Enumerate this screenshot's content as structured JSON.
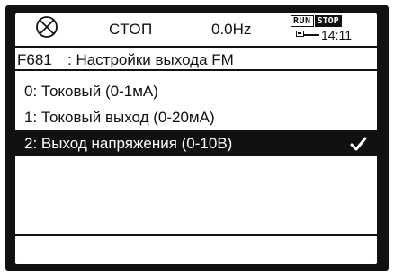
{
  "status": {
    "mode": "СТОП",
    "frequency": "0.0Hz",
    "run_label": "RUN",
    "stop_label": "STOP",
    "clock": "14:11"
  },
  "parameter": {
    "code": "F681",
    "title": ": Настройки выхода FM"
  },
  "options": [
    {
      "label": "0: Токовый (0-1мА)",
      "selected": false
    },
    {
      "label": "1: Токовый выход (0-20мА)",
      "selected": false
    },
    {
      "label": "2: Выход напряжения (0-10В)",
      "selected": true
    }
  ],
  "icons": {
    "stop_status": "circle-x-icon",
    "battery": "battery-icon",
    "selected_check": "checkmark-icon"
  },
  "colors": {
    "foreground": "#111111",
    "background": "#ffffff",
    "selection": "#111111"
  }
}
